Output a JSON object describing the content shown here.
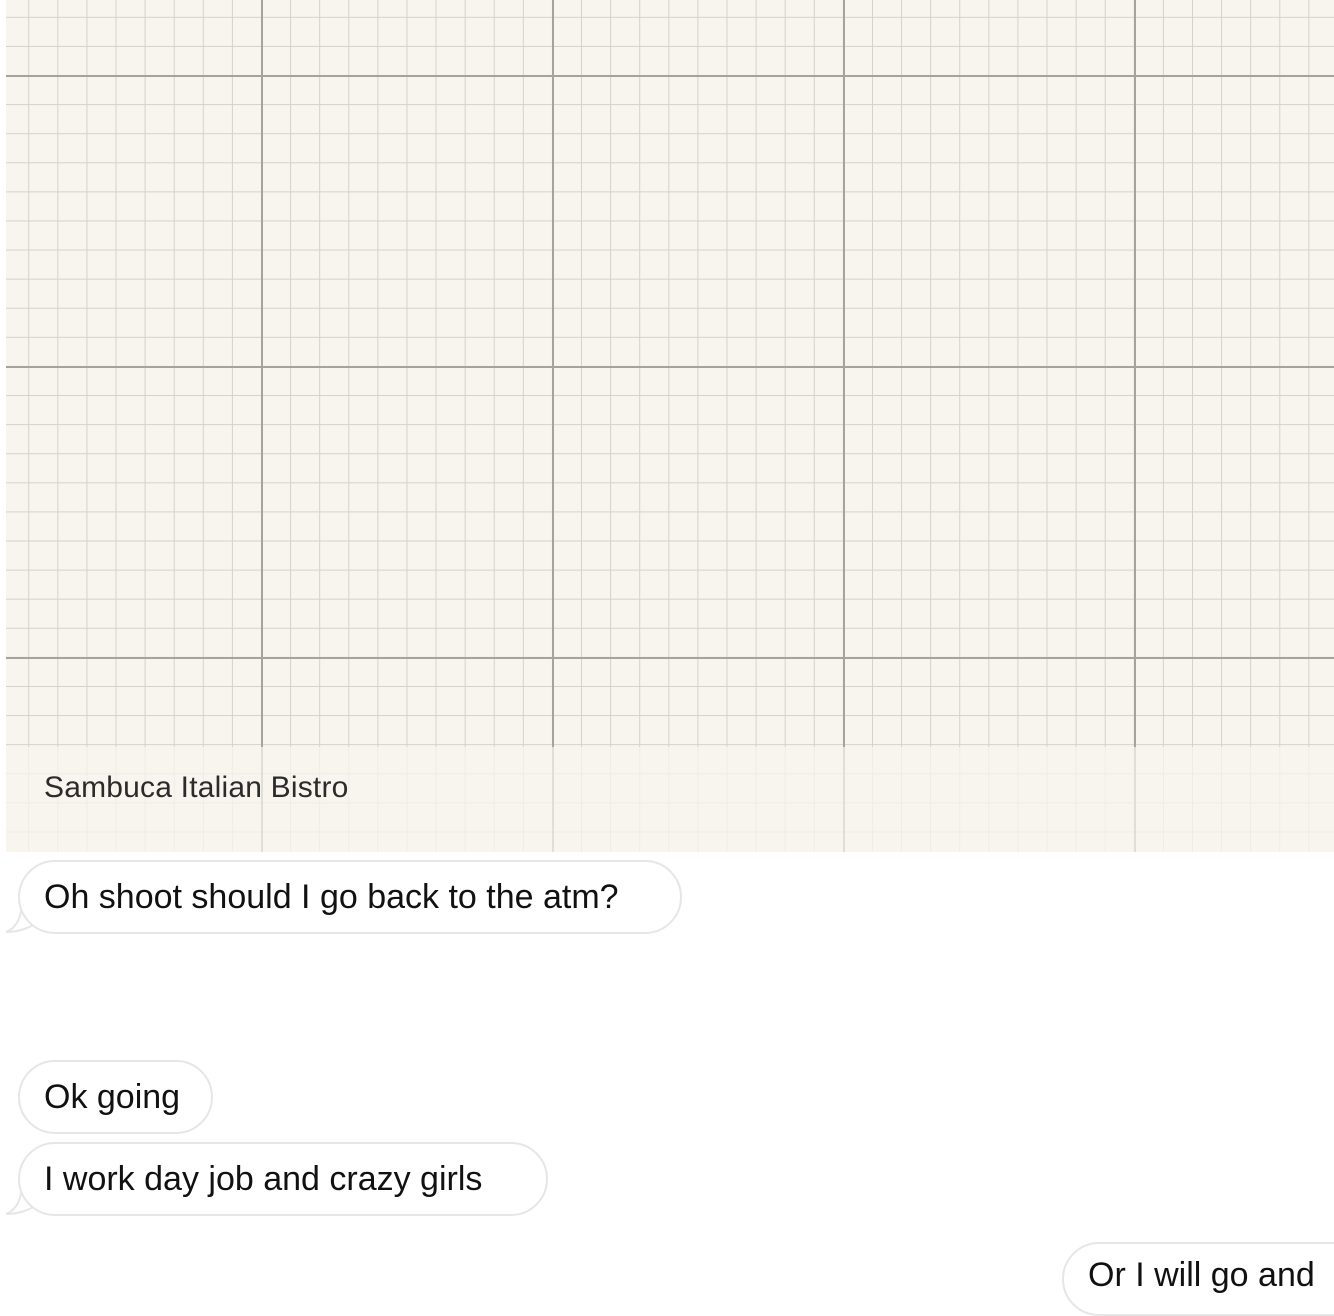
{
  "location_card": {
    "place_name": "Sambuca Italian Bistro"
  },
  "messages": [
    {
      "text": "Oh shoot should I go back to the atm?"
    },
    {
      "text": "Ok going"
    },
    {
      "text": "I work day job and crazy girls"
    },
    {
      "text": "Or I will go and"
    }
  ],
  "colors": {
    "map_background": "#f8f4ee",
    "bubble_background": "#ffffff",
    "bubble_border": "#e6e6e6"
  }
}
